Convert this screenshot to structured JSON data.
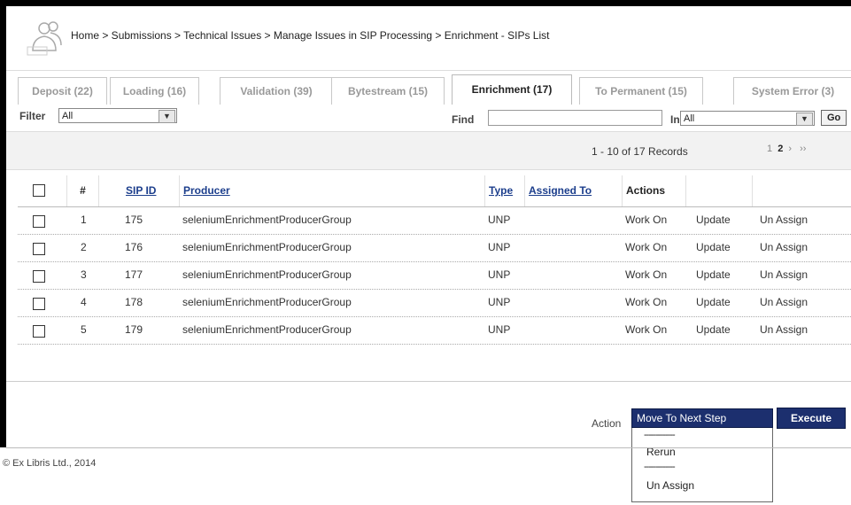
{
  "breadcrumb": "Home > Submissions > Technical Issues > Manage Issues in SIP Processing > Enrichment - SIPs List",
  "tabs": [
    {
      "label": "Deposit (22)"
    },
    {
      "label": "Loading (16)"
    },
    {
      "label": "Validation (39)"
    },
    {
      "label": "Bytestream (15)"
    },
    {
      "label": "Enrichment (17)",
      "active": true
    },
    {
      "label": "To Permanent (15)"
    },
    {
      "label": "System Error (3)"
    }
  ],
  "filter": {
    "label": "Filter",
    "value": "All"
  },
  "find": {
    "label": "Find",
    "value": "",
    "in_label": "In",
    "in_value": "All",
    "go_label": "Go"
  },
  "records": "1 - 10 of 17 Records",
  "pager": {
    "first": "1",
    "current": "2",
    "next": "›",
    "last": "››"
  },
  "table": {
    "columns": [
      "#",
      "SIP ID",
      "Producer",
      "Type",
      "Assigned To",
      "Actions"
    ],
    "rows": [
      {
        "num": "1",
        "sip_id": "175",
        "producer": "seleniumEnrichmentProducerGroup",
        "type": "UNP",
        "assigned": "",
        "work_on": "Work On",
        "update": "Update",
        "unassign": "Un Assign"
      },
      {
        "num": "2",
        "sip_id": "176",
        "producer": "seleniumEnrichmentProducerGroup",
        "type": "UNP",
        "assigned": "",
        "work_on": "Work On",
        "update": "Update",
        "unassign": "Un Assign"
      },
      {
        "num": "3",
        "sip_id": "177",
        "producer": "seleniumEnrichmentProducerGroup",
        "type": "UNP",
        "assigned": "",
        "work_on": "Work On",
        "update": "Update",
        "unassign": "Un Assign"
      },
      {
        "num": "4",
        "sip_id": "178",
        "producer": "seleniumEnrichmentProducerGroup",
        "type": "UNP",
        "assigned": "",
        "work_on": "Work On",
        "update": "Update",
        "unassign": "Un Assign"
      },
      {
        "num": "5",
        "sip_id": "179",
        "producer": "seleniumEnrichmentProducerGroup",
        "type": "UNP",
        "assigned": "",
        "work_on": "Work On",
        "update": "Update",
        "unassign": "Un Assign"
      }
    ]
  },
  "action": {
    "label": "Action",
    "selected": "Move To Next Step",
    "separator": "-------------",
    "options": [
      "Move To Next Step",
      "Rerun",
      "Un Assign"
    ],
    "execute_label": "Execute"
  },
  "footer": {
    "copyright": "© Ex Libris Ltd., 2014"
  },
  "colors": {
    "navy": "#1c2f6e",
    "link": "#1c3e8c"
  }
}
